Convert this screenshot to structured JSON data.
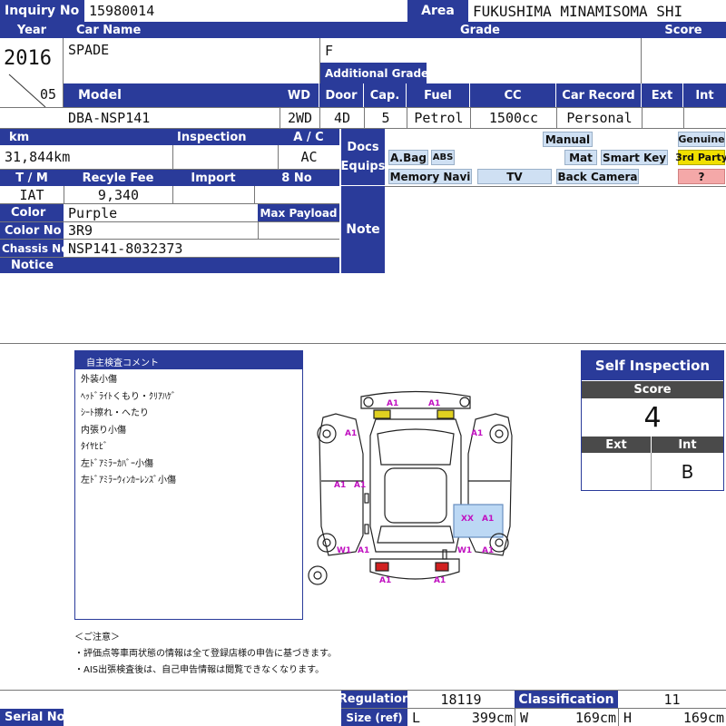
{
  "header": {
    "inquiry_label": "Inquiry No",
    "inquiry_no": "15980014",
    "area_label": "Area",
    "area": "FUKUSHIMA MINAMISOMA SHI"
  },
  "vehicle": {
    "year_label": "Year",
    "year": "2016",
    "month": "05",
    "car_name_label": "Car Name",
    "car_name": "SPADE",
    "grade_label": "Grade",
    "grade": "F",
    "additional_grade_label": "Additional Grade",
    "additional_grade": "",
    "score_label": "Score",
    "score": ""
  },
  "spec": {
    "model_label": "Model",
    "model": "DBA-NSP141",
    "wd_label": "WD",
    "wd": "2WD",
    "door_label": "Door",
    "door": "4D",
    "cap_label": "Cap.",
    "cap": "5",
    "fuel_label": "Fuel",
    "fuel": "Petrol",
    "cc_label": "CC",
    "cc": "1500cc",
    "record_label": "Car Record",
    "record": "Personal",
    "ext_label": "Ext",
    "int_label": "Int"
  },
  "details": {
    "km_label": "km",
    "km": "31,844km",
    "inspection_label": "Inspection",
    "inspection": "",
    "ac_label": "A / C",
    "ac": "AC",
    "tm_label": "T / M",
    "tm": "IAT",
    "recycle_label": "Recyle Fee",
    "recycle": "9,340",
    "import_label": "Import",
    "eight_no_label": "8 No",
    "color_label": "Color",
    "color": "Purple",
    "max_payload_label": "Max Payload",
    "color_no_label": "Color No",
    "color_no": "3R9",
    "chassis_label": "Chassis No",
    "chassis": "NSP141-8032373",
    "notice_label": "Notice",
    "docs_label": "Docs",
    "equips_label": "Equips",
    "note_label": "Note"
  },
  "equipment": {
    "manual": "Manual",
    "genuine": "Genuine",
    "abag": "A.Bag",
    "abs": "ABS",
    "mat": "Mat",
    "smart_key": "Smart Key",
    "third_party": "3rd Party",
    "memory_navi": "Memory Navi",
    "tv": "TV",
    "back_camera": "Back Camera",
    "question": "?"
  },
  "inspection_comment": {
    "title": "自主検査コメント",
    "lines": [
      "外装小傷",
      "ﾍｯﾄﾞﾗｲﾄくもり・ｸﾘｱﾊｹﾞ",
      "ｼｰﾄ擦れ・へたり",
      "内張り小傷",
      "ﾀｲﾔﾋﾋﾞ",
      "左ﾄﾞｱﾐﾗｰｶﾊﾞｰ小傷",
      "左ﾄﾞｱﾐﾗｰｳｨﾝｶｰﾚﾝｽﾞ小傷"
    ]
  },
  "diagram": {
    "marks": [
      "A1",
      "A1",
      "A1",
      "A1",
      "A1",
      "A1",
      "XX",
      "A1",
      "W1",
      "A1",
      "W1",
      "A1",
      "A1",
      "A1"
    ],
    "colors": {
      "headlight": "#e0d020",
      "taillight": "#d02020",
      "damaged_panel": "#bcd8f4",
      "mark": "#c010c0"
    }
  },
  "self_inspection": {
    "title": "Self Inspection",
    "score_label": "Score",
    "score": "4",
    "ext_label": "Ext",
    "ext": "",
    "int_label": "Int",
    "int": "B"
  },
  "notes": {
    "heading": "＜ご注意＞",
    "line1": "・評価点等車両状態の情報は全て登録店様の申告に基づきます。",
    "line2": "・AIS出張検査後は、自己申告情報は閲覧できなくなります。"
  },
  "footer": {
    "serial_label": "Serial No",
    "serial": "",
    "regulation_label": "Regulation",
    "regulation": "18119",
    "classification_label": "Classification",
    "classification": "11",
    "size_label": "Size (ref)",
    "l_label": "L",
    "l": "399cm",
    "w_label": "W",
    "w": "169cm",
    "h_label": "H",
    "h": "169cm"
  },
  "theme": {
    "header_bg": "#2a3b9a",
    "chip_bg": "#cfe0f3",
    "third_party_bg": "#f0e000",
    "question_bg": "#f4a8a8"
  }
}
